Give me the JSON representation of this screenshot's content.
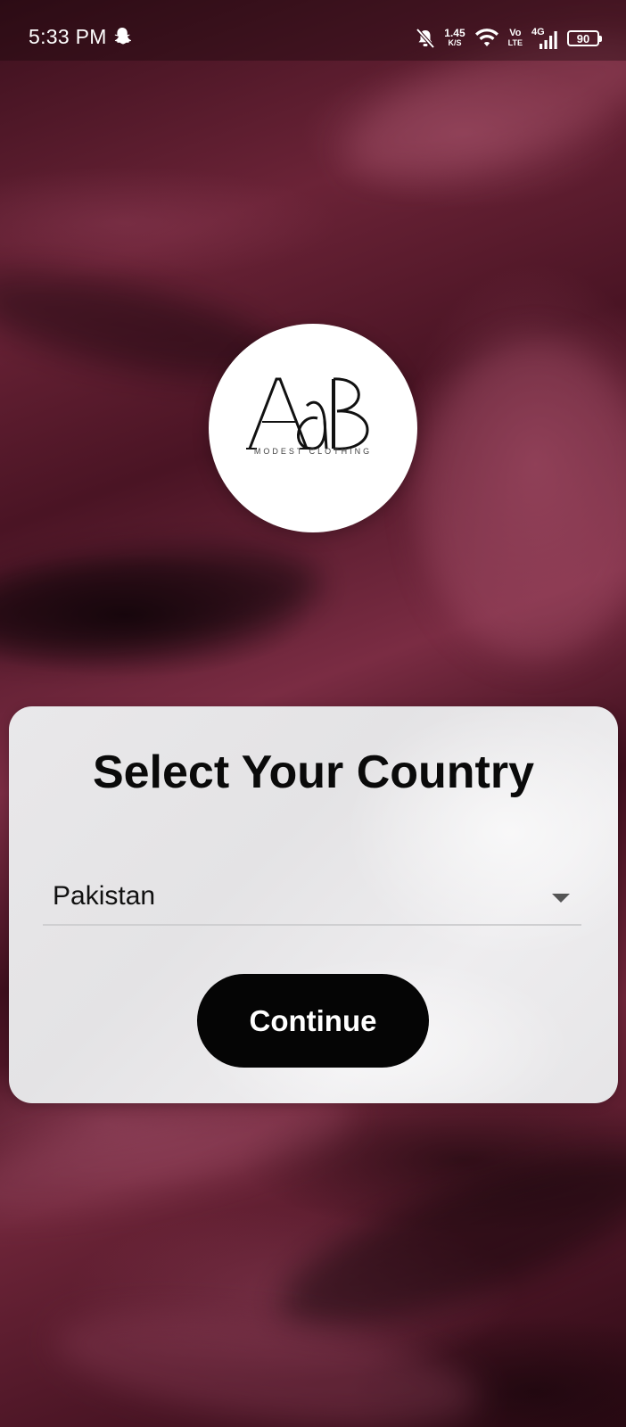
{
  "status_bar": {
    "time": "5:33 PM",
    "speed_value": "1.45",
    "speed_unit": "K/S",
    "volte_top": "Vo",
    "volte_bottom": "LTE",
    "network_label": "4G",
    "battery_level": "90",
    "icons": [
      "snapchat-icon",
      "bell-muted-icon",
      "wifi-icon",
      "signal-icon",
      "battery-icon"
    ]
  },
  "logo": {
    "caption": "MODEST CLOTHING",
    "letters": "AaB"
  },
  "card": {
    "title": "Select Your Country",
    "country_select": {
      "selected": "Pakistan"
    },
    "continue_label": "Continue"
  },
  "colors": {
    "background": "#5a1a2c",
    "card": "#e8e7e9",
    "button": "#050505",
    "button_text": "#ffffff"
  }
}
